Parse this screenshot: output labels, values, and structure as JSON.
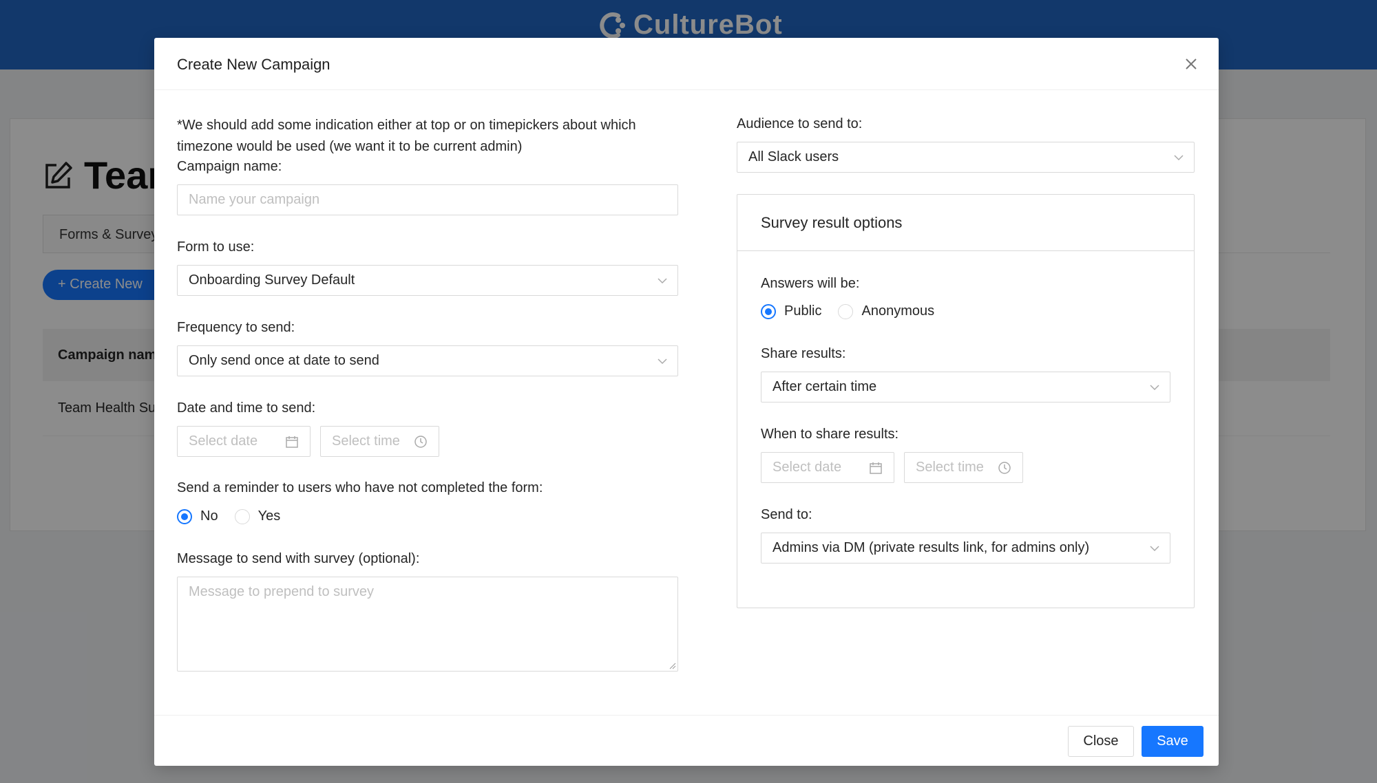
{
  "app": {
    "brand": "CultureBot"
  },
  "background": {
    "page_title": "Team",
    "tab_label": "Forms & Survey",
    "create_button": "+  Create New",
    "table_header": "Campaign nam",
    "table_row": "Team Health Su"
  },
  "modal": {
    "title": "Create New Campaign",
    "note": "*We should add some indication either at top or on timepickers about which timezone would be used (we want it to be current admin)",
    "campaign_name": {
      "label": "Campaign name:",
      "placeholder": "Name your campaign"
    },
    "form": {
      "label": "Form to use:",
      "value": "Onboarding Survey Default"
    },
    "frequency": {
      "label": "Frequency to send:",
      "value": "Only send once at date to send"
    },
    "date_time": {
      "label": "Date and time to send:",
      "date_placeholder": "Select date",
      "time_placeholder": "Select time"
    },
    "reminder": {
      "label": "Send a reminder to users who have not completed the form:",
      "options": [
        "No",
        "Yes"
      ],
      "selected": "No"
    },
    "message": {
      "label": "Message to send with survey (optional):",
      "placeholder": "Message to prepend to survey"
    },
    "audience": {
      "label": "Audience to send to:",
      "value": "All Slack users"
    },
    "survey_options": {
      "title": "Survey result options",
      "answers": {
        "label": "Answers will be:",
        "options": [
          "Public",
          "Anonymous"
        ],
        "selected": "Public"
      },
      "share": {
        "label": "Share results:",
        "value": "After certain time"
      },
      "when": {
        "label": "When to share results:",
        "date_placeholder": "Select date",
        "time_placeholder": "Select time"
      },
      "send_to": {
        "label": "Send to:",
        "value": "Admins via DM (private results link, for admins only)"
      }
    },
    "footer": {
      "close_label": "Close",
      "save_label": "Save"
    }
  },
  "colors": {
    "primary": "#1677ff",
    "header": "#2266c4"
  }
}
